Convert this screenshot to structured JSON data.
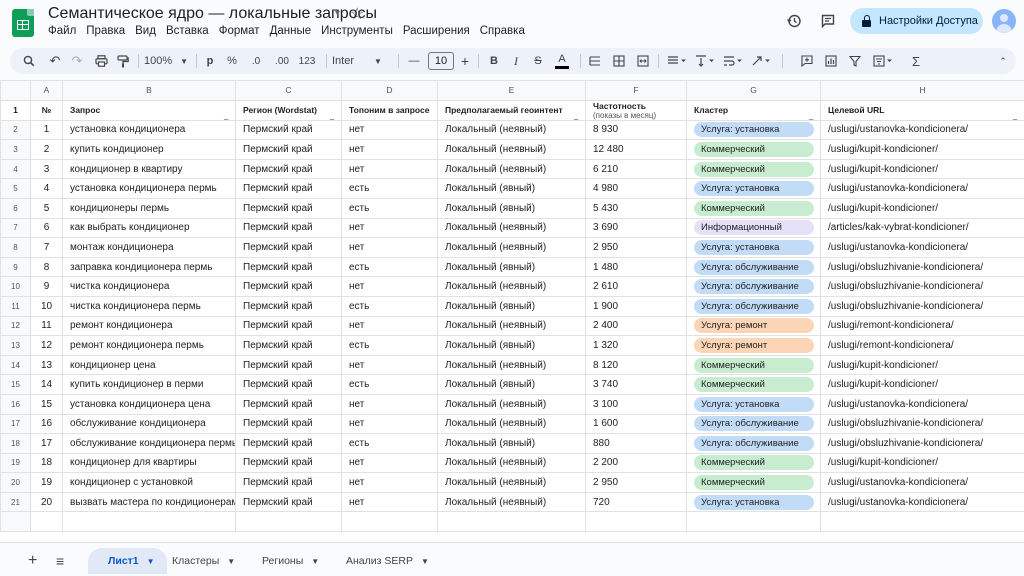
{
  "app": {
    "title": "Семантическое ядро — локальные запросы",
    "menu": [
      "Файл",
      "Правка",
      "Вид",
      "Вставка",
      "Формат",
      "Данные",
      "Инструменты",
      "Расширения",
      "Справка"
    ],
    "share_label": "Настройки Доступа"
  },
  "toolbar": {
    "zoom": "100%",
    "currency": "р",
    "percent": "%",
    "dec_decrease": ".0",
    "dec_increase": ".00",
    "format_123": "123",
    "font": "Inter",
    "font_size": "10",
    "minus": "—",
    "plus": "+",
    "bold": "B",
    "italic": "I",
    "strike": "S",
    "text_color_glyph": "A",
    "sigma": "Σ"
  },
  "columns": [
    "A",
    "B",
    "C",
    "D",
    "E",
    "F",
    "G",
    "H"
  ],
  "header_row": {
    "rownum": "1",
    "cells": [
      "№",
      "Запрос",
      "Регион (Wordstat)",
      "Топоним в запросе",
      "Предполагаемый геоинтент",
      "Частотность",
      "Кластер",
      "Целевой URL"
    ],
    "freq_sub": "(показы в месяц)"
  },
  "cluster_colors": {
    "Услуга: установка": "#c2dcf8",
    "Коммерческий": "#c8ecd0",
    "Информационный": "#e6e0f8",
    "Услуга: обслуживание": "#c2dcf8",
    "Услуга: ремонт": "#fbd5b5"
  },
  "rows": [
    {
      "rownum": "2",
      "n": "1",
      "query": "установка кондиционера",
      "region": "Пермский край",
      "toponym": "нет",
      "geo": "Локальный (неявный)",
      "freq": "8 930",
      "cluster": "Услуга: установка",
      "url": "/uslugi/ustanovka-kondicionera/"
    },
    {
      "rownum": "3",
      "n": "2",
      "query": "купить кондиционер",
      "region": "Пермский край",
      "toponym": "нет",
      "geo": "Локальный (неявный)",
      "freq": "12 480",
      "cluster": "Коммерческий",
      "url": "/uslugi/kupit-kondicioner/"
    },
    {
      "rownum": "4",
      "n": "3",
      "query": "кондиционер в квартиру",
      "region": "Пермский край",
      "toponym": "нет",
      "geo": "Локальный (неявный)",
      "freq": "6 210",
      "cluster": "Коммерческий",
      "url": "/uslugi/kupit-kondicioner/"
    },
    {
      "rownum": "5",
      "n": "4",
      "query": "установка кондиционера пермь",
      "region": "Пермский край",
      "toponym": "есть",
      "geo": "Локальный (явный)",
      "freq": "4 980",
      "cluster": "Услуга: установка",
      "url": "/uslugi/ustanovka-kondicionera/"
    },
    {
      "rownum": "6",
      "n": "5",
      "query": "кондиционеры пермь",
      "region": "Пермский край",
      "toponym": "есть",
      "geo": "Локальный (явный)",
      "freq": "5 430",
      "cluster": "Коммерческий",
      "url": "/uslugi/kupit-kondicioner/"
    },
    {
      "rownum": "7",
      "n": "6",
      "query": "как выбрать кондиционер",
      "region": "Пермский край",
      "toponym": "нет",
      "geo": "Локальный (неявный)",
      "freq": "3 690",
      "cluster": "Информационный",
      "url": "/articles/kak-vybrat-kondicioner/"
    },
    {
      "rownum": "8",
      "n": "7",
      "query": "монтаж кондиционера",
      "region": "Пермский край",
      "toponym": "нет",
      "geo": "Локальный (неявный)",
      "freq": "2 950",
      "cluster": "Услуга: установка",
      "url": "/uslugi/ustanovka-kondicionera/"
    },
    {
      "rownum": "9",
      "n": "8",
      "query": "заправка кондиционера пермь",
      "region": "Пермский край",
      "toponym": "есть",
      "geo": "Локальный (явный)",
      "freq": "1 480",
      "cluster": "Услуга: обслуживание",
      "url": "/uslugi/obsluzhivanie-kondicionera/"
    },
    {
      "rownum": "10",
      "n": "9",
      "query": "чистка кондиционера",
      "region": "Пермский край",
      "toponym": "нет",
      "geo": "Локальный (неявный)",
      "freq": "2 610",
      "cluster": "Услуга: обслуживание",
      "url": "/uslugi/obsluzhivanie-kondicionera/"
    },
    {
      "rownum": "11",
      "n": "10",
      "query": "чистка кондиционера пермь",
      "region": "Пермский край",
      "toponym": "есть",
      "geo": "Локальный (явный)",
      "freq": "1 900",
      "cluster": "Услуга: обслуживание",
      "url": "/uslugi/obsluzhivanie-kondicionera/"
    },
    {
      "rownum": "12",
      "n": "11",
      "query": "ремонт кондиционера",
      "region": "Пермский край",
      "toponym": "нет",
      "geo": "Локальный (неявный)",
      "freq": "2 400",
      "cluster": "Услуга: ремонт",
      "url": "/uslugi/remont-kondicionera/"
    },
    {
      "rownum": "13",
      "n": "12",
      "query": "ремонт кондиционера пермь",
      "region": "Пермский край",
      "toponym": "есть",
      "geo": "Локальный (явный)",
      "freq": "1 320",
      "cluster": "Услуга: ремонт",
      "url": "/uslugi/remont-kondicionera/"
    },
    {
      "rownum": "14",
      "n": "13",
      "query": "кондиционер цена",
      "region": "Пермский край",
      "toponym": "нет",
      "geo": "Локальный (неявный)",
      "freq": "8 120",
      "cluster": "Коммерческий",
      "url": "/uslugi/kupit-kondicioner/"
    },
    {
      "rownum": "15",
      "n": "14",
      "query": "купить кондиционер в перми",
      "region": "Пермский край",
      "toponym": "есть",
      "geo": "Локальный (явный)",
      "freq": "3 740",
      "cluster": "Коммерческий",
      "url": "/uslugi/kupit-kondicioner/"
    },
    {
      "rownum": "16",
      "n": "15",
      "query": "установка кондиционера цена",
      "region": "Пермский край",
      "toponym": "нет",
      "geo": "Локальный (неявный)",
      "freq": "3 100",
      "cluster": "Услуга: установка",
      "url": "/uslugi/ustanovka-kondicionera/"
    },
    {
      "rownum": "17",
      "n": "16",
      "query": "обслуживание кондиционера",
      "region": "Пермский край",
      "toponym": "нет",
      "geo": "Локальный (неявный)",
      "freq": "1 600",
      "cluster": "Услуга: обслуживание",
      "url": "/uslugi/obsluzhivanie-kondicionera/"
    },
    {
      "rownum": "18",
      "n": "17",
      "query": "обслуживание кондиционера пермь",
      "region": "Пермский край",
      "toponym": "есть",
      "geo": "Локальный (явный)",
      "freq": "880",
      "cluster": "Услуга: обслуживание",
      "url": "/uslugi/obsluzhivanie-kondicionera/"
    },
    {
      "rownum": "19",
      "n": "18",
      "query": "кондиционер для квартиры",
      "region": "Пермский край",
      "toponym": "нет",
      "geo": "Локальный (неявный)",
      "freq": "2 200",
      "cluster": "Коммерческий",
      "url": "/uslugi/kupit-kondicioner/"
    },
    {
      "rownum": "20",
      "n": "19",
      "query": "кондиционер с установкой",
      "region": "Пермский край",
      "toponym": "нет",
      "geo": "Локальный (неявный)",
      "freq": "2 950",
      "cluster": "Коммерческий",
      "url": "/uslugi/ustanovka-kondicionera/"
    },
    {
      "rownum": "21",
      "n": "20",
      "query": "вызвать мастера по кондиционерам",
      "region": "Пермский край",
      "toponym": "нет",
      "geo": "Локальный (неявный)",
      "freq": "720",
      "cluster": "Услуга: установка",
      "url": "/uslugi/ustanovka-kondicionera/"
    }
  ],
  "rownum_labels": [
    "2",
    "3",
    "4",
    "5",
    "6",
    "7",
    "8",
    "9",
    "10",
    "11",
    "12",
    "13",
    "14",
    "15",
    "16",
    "17",
    "18",
    "19",
    "20"
  ],
  "tabs": {
    "add": "+",
    "list": "≡",
    "items": [
      "Лист1",
      "Кластеры",
      "Регионы",
      "Анализ SERP"
    ]
  }
}
